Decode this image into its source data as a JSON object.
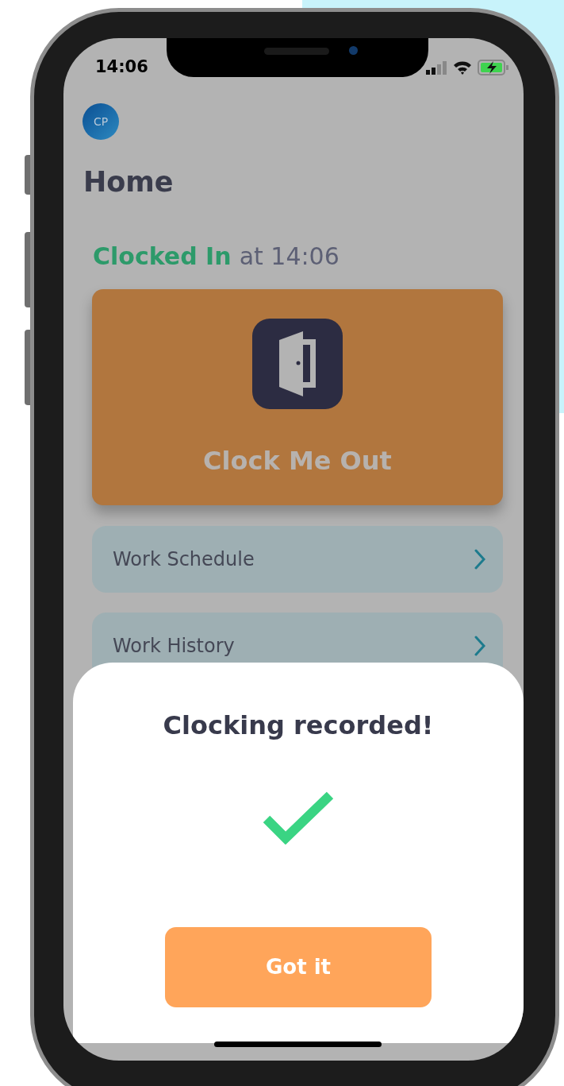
{
  "status_bar": {
    "time": "14:06"
  },
  "avatar": {
    "initials": "CP"
  },
  "title": "Home",
  "clock_status": {
    "state": "Clocked In",
    "detail": "at 14:06"
  },
  "clock_button": {
    "label": "Clock Me Out"
  },
  "menu": [
    {
      "label": "Work Schedule"
    },
    {
      "label": "Work History"
    }
  ],
  "dialog": {
    "title": "Clocking recorded!",
    "button": "Got it"
  }
}
